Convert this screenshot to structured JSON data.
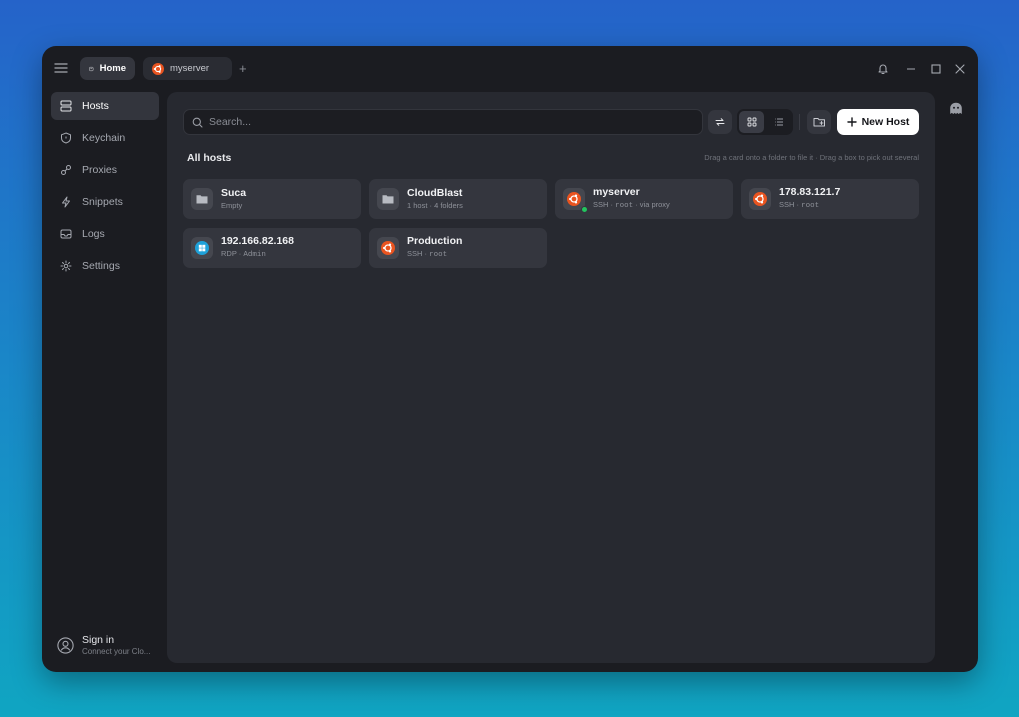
{
  "titlebar": {
    "tabs": [
      {
        "label": "Home",
        "icon": "home-icon",
        "active": true
      },
      {
        "label": "myserver",
        "icon": "ubuntu-icon",
        "active": false
      }
    ],
    "new_tab_label": "+"
  },
  "sidebar": {
    "items": [
      {
        "label": "Hosts",
        "icon": "server-icon",
        "active": true
      },
      {
        "label": "Keychain",
        "icon": "shield-icon",
        "active": false
      },
      {
        "label": "Proxies",
        "icon": "link-icon",
        "active": false
      },
      {
        "label": "Snippets",
        "icon": "bolt-icon",
        "active": false
      },
      {
        "label": "Logs",
        "icon": "inbox-icon",
        "active": false
      },
      {
        "label": "Settings",
        "icon": "gear-icon",
        "active": false
      }
    ],
    "signin": {
      "title": "Sign in",
      "subtitle": "Connect your Clo..."
    }
  },
  "main": {
    "search": {
      "placeholder": "Search..."
    },
    "new_host_label": "New Host",
    "section_title": "All hosts",
    "hint": "Drag a card onto a folder to file it · Drag a box to pick out several",
    "cards": [
      {
        "title": "Suca",
        "type": "folder",
        "sub": "Empty"
      },
      {
        "title": "CloudBlast",
        "type": "folder",
        "sub": "1 host · 4 folders"
      },
      {
        "title": "myserver",
        "type": "ubuntu",
        "protocol": "SSH",
        "user": "root",
        "extra": "via proxy",
        "online": true
      },
      {
        "title": "178.83.121.7",
        "type": "ubuntu",
        "protocol": "SSH",
        "user": "root"
      },
      {
        "title": "192.166.82.168",
        "type": "windows",
        "protocol": "RDP",
        "user": "Admin"
      },
      {
        "title": "Production",
        "type": "ubuntu",
        "protocol": "SSH",
        "user": "root"
      }
    ]
  },
  "colors": {
    "ubuntu": "#e95420",
    "windows": "#1ea1d9",
    "online": "#22c55e",
    "accent_button": "#ffffff"
  }
}
